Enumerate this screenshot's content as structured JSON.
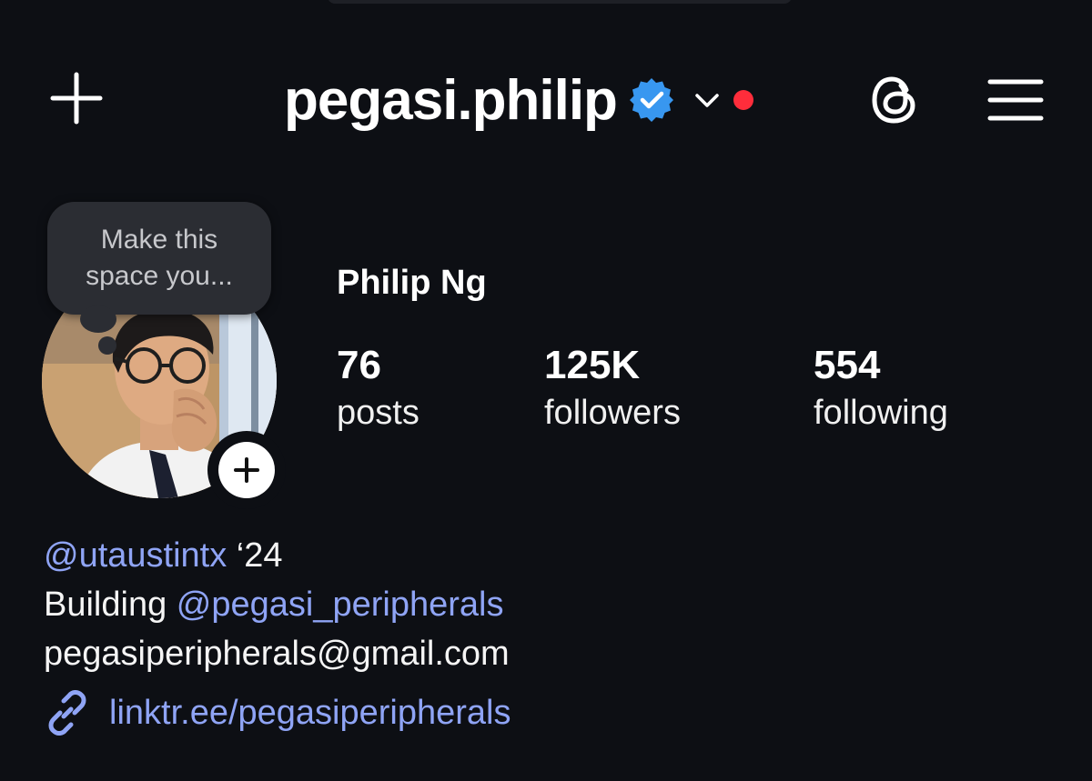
{
  "header": {
    "username": "pegasi.philip",
    "icons": {
      "create": "plus-icon",
      "verified": "verified-badge-icon",
      "account_switch": "chevron-down-icon",
      "notification_dot": "red-dot",
      "threads": "threads-icon",
      "menu": "hamburger-menu-icon"
    },
    "colors": {
      "verified": "#3897f0",
      "notification_dot": "#ff2d3b"
    }
  },
  "note": {
    "text": "Make this\nspace you..."
  },
  "profile": {
    "display_name": "Philip Ng",
    "stats": [
      {
        "value": "76",
        "label": "posts"
      },
      {
        "value": "125K",
        "label": "followers"
      },
      {
        "value": "554",
        "label": "following"
      }
    ]
  },
  "bio": {
    "line1_mention": "@utaustintx",
    "line1_rest": " ‘24",
    "line2_prefix": "Building ",
    "line2_mention": "@pegasi_peripherals",
    "line3": "pegasiperipherals@gmail.com",
    "link": "linktr.ee/pegasiperipherals"
  },
  "theme": {
    "background": "#0d0f14",
    "link_color": "#8fa4f5",
    "note_bubble": "#2b2d33"
  }
}
